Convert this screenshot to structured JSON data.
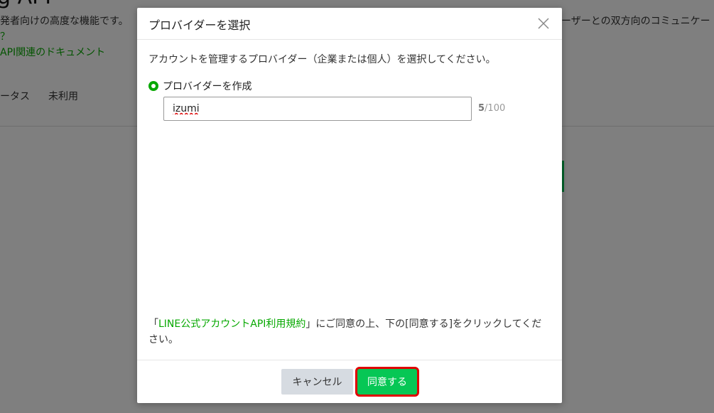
{
  "background": {
    "title": "g API",
    "description_left": "発者向けの高度な機能です。",
    "description_right": "ーザーとの双方向のコミュニケー",
    "link_question": "？",
    "link_docs": "API関連のドキュメント",
    "status_label": "ータス",
    "status_value": "未利用"
  },
  "modal": {
    "title": "プロバイダーを選択",
    "close_icon": "close-icon",
    "instruction": "アカウントを管理するプロバイダー（企業または個人）を選択してください。",
    "radio_label": "プロバイダーを作成",
    "input_value": "izumi",
    "char_count_current": "5",
    "char_count_max": "/100",
    "terms_prefix": "「",
    "terms_link": "LINE公式アカウントAPI利用規約",
    "terms_suffix": "」にご同意の上、下の[同意する]をクリックしてください。",
    "cancel_label": "キャンセル",
    "agree_label": "同意する"
  },
  "colors": {
    "accent_green": "#06c755",
    "link_green": "#06a800",
    "highlight_red": "#e00000"
  }
}
